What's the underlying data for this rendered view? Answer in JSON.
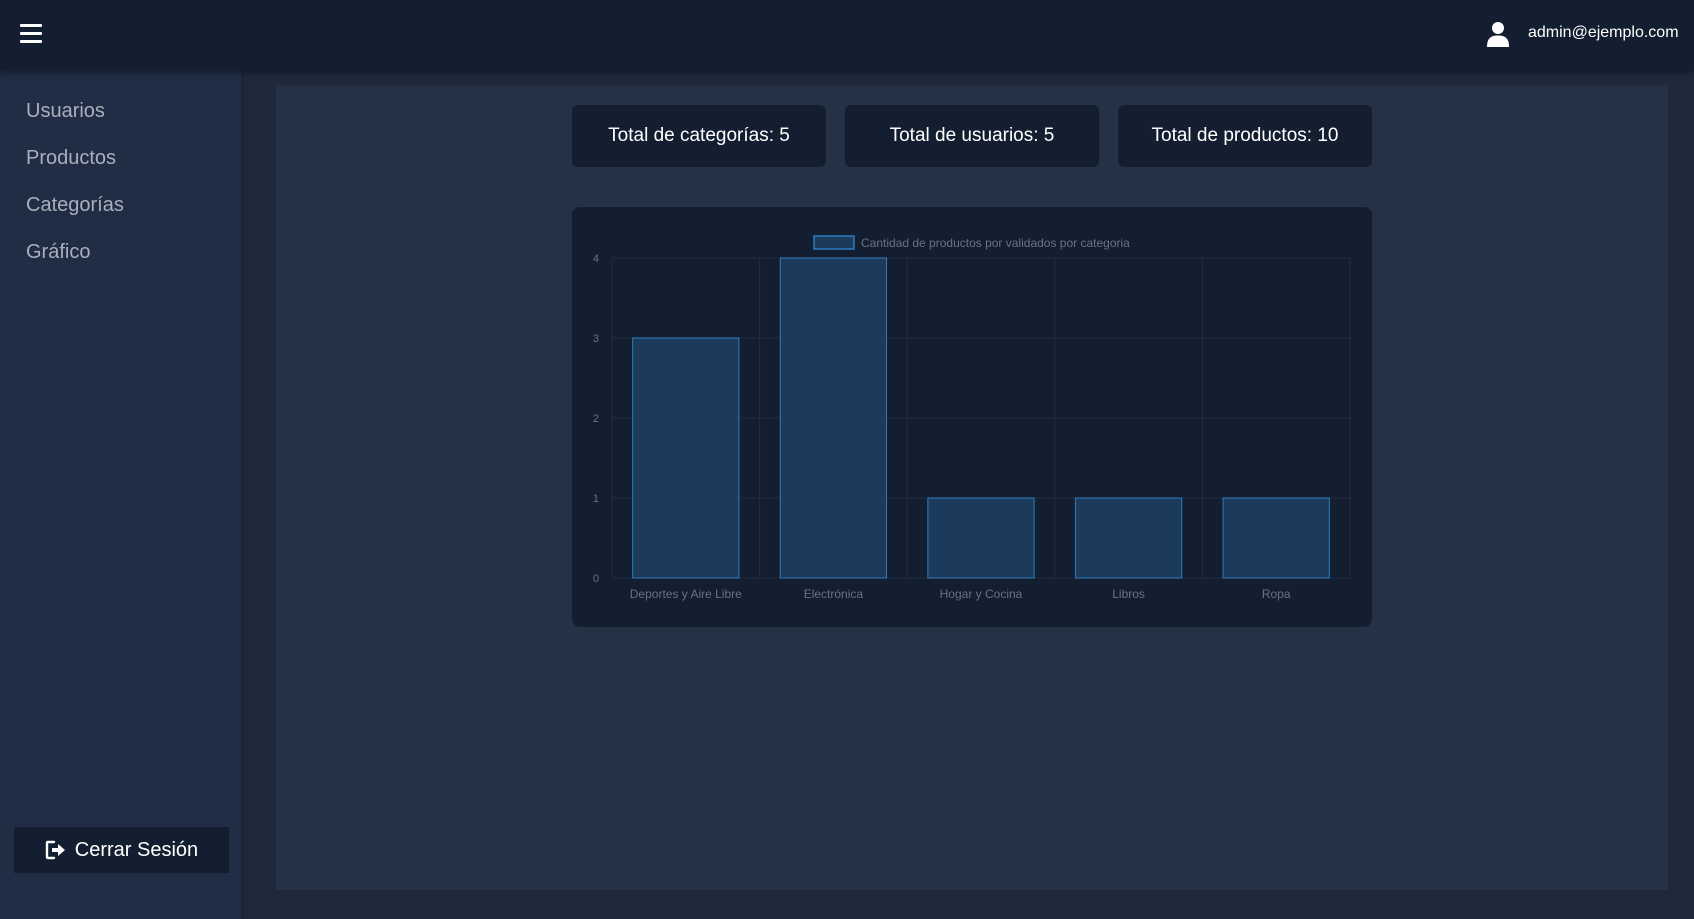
{
  "header": {
    "menu_icon": "hamburger-menu-icon",
    "user_icon": "user-icon",
    "user_email": "admin@ejemplo.com"
  },
  "sidebar": {
    "items": [
      {
        "label": "Usuarios"
      },
      {
        "label": "Productos"
      },
      {
        "label": "Categorías"
      },
      {
        "label": "Gráfico"
      }
    ],
    "logout_label": "Cerrar Sesión",
    "logout_icon": "sign-out-icon"
  },
  "stats": {
    "categories": "Total de categorías: 5",
    "users": "Total de usuarios: 5",
    "products": "Total de productos: 10"
  },
  "colors": {
    "background": "#1e293b",
    "topbar": "#131e30",
    "sidebar": "#202d44",
    "content": "#253145",
    "card": "#131e30",
    "bar_fill": "#1b3a5c",
    "bar_border": "#2f7cc0"
  },
  "chart_data": {
    "type": "bar",
    "categories": [
      "Deportes y Aire Libre",
      "Electrónica",
      "Hogar y Cocina",
      "Libros",
      "Ropa"
    ],
    "series": [
      {
        "name": "Cantidad de productos por validados por categoria",
        "values": [
          3,
          4,
          1,
          1,
          1
        ]
      }
    ],
    "ylim": [
      0,
      4
    ],
    "yticks": [
      "0",
      "1",
      "2",
      "3",
      "4"
    ],
    "grid": true,
    "legend": "top-center"
  }
}
